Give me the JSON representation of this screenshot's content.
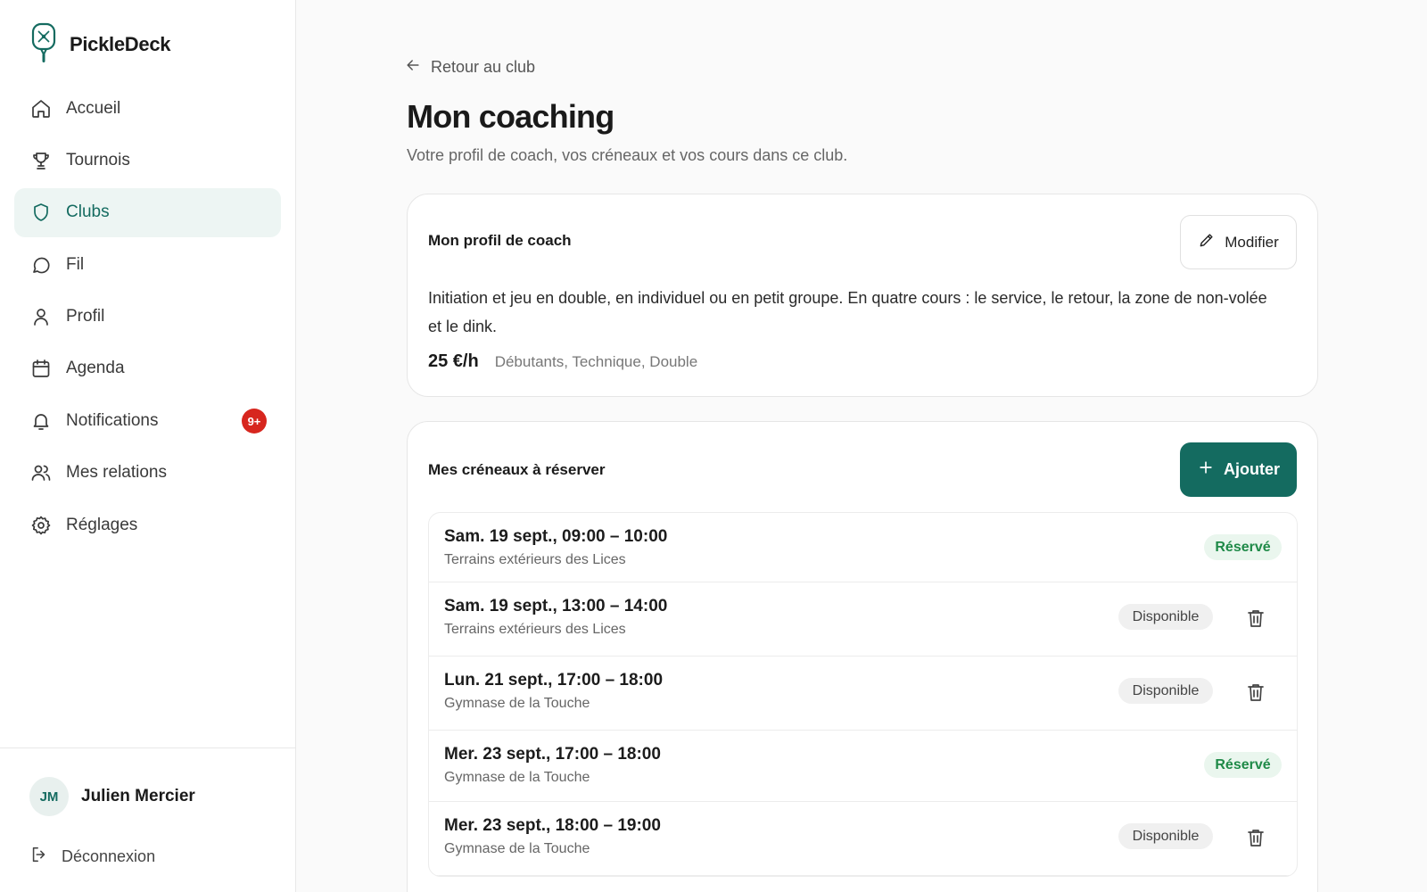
{
  "app": {
    "name": "PickleDeck"
  },
  "sidebar": {
    "items": [
      {
        "label": "Accueil",
        "icon": "home-icon"
      },
      {
        "label": "Tournois",
        "icon": "trophy-icon"
      },
      {
        "label": "Clubs",
        "icon": "shield-icon",
        "active": true
      },
      {
        "label": "Fil",
        "icon": "chat-icon"
      },
      {
        "label": "Profil",
        "icon": "user-icon"
      },
      {
        "label": "Agenda",
        "icon": "calendar-icon"
      },
      {
        "label": "Notifications",
        "icon": "bell-icon",
        "badge": "9+"
      },
      {
        "label": "Mes relations",
        "icon": "users-icon"
      },
      {
        "label": "Réglages",
        "icon": "gear-icon"
      }
    ],
    "user": {
      "initials": "JM",
      "name": "Julien Mercier"
    },
    "logout_label": "Déconnexion"
  },
  "main": {
    "back_label": "Retour au club",
    "title": "Mon coaching",
    "subtitle": "Votre profil de coach, vos créneaux et vos cours dans ce club.",
    "profile_card": {
      "title": "Mon profil de coach",
      "edit_label": "Modifier",
      "description": "Initiation et jeu en double, en individuel ou en petit groupe. En quatre cours : le service, le retour, la zone de non-volée et le dink.",
      "price": "25 €/h",
      "tags": "Débutants, Technique, Double"
    },
    "slots_card": {
      "title": "Mes créneaux à réserver",
      "add_label": "Ajouter",
      "slots": [
        {
          "date": "Sam. 19 sept., 09:00 – 10:00",
          "place": "Terrains extérieurs des Lices",
          "status": "Réservé"
        },
        {
          "date": "Sam. 19 sept., 13:00 – 14:00",
          "place": "Terrains extérieurs des Lices",
          "status": "Disponible"
        },
        {
          "date": "Lun. 21 sept., 17:00 – 18:00",
          "place": "Gymnase de la Touche",
          "status": "Disponible"
        },
        {
          "date": "Mer. 23 sept., 17:00 – 18:00",
          "place": "Gymnase de la Touche",
          "status": "Réservé"
        },
        {
          "date": "Mer. 23 sept., 18:00 – 19:00",
          "place": "Gymnase de la Touche",
          "status": "Disponible"
        }
      ]
    }
  },
  "colors": {
    "accent": "#146b60",
    "active_bg": "#edf5f3",
    "badge": "#d7261e",
    "reserved_text": "#1f8a48",
    "reserved_bg": "#eaf6ee",
    "available_bg": "#f0f0f0"
  }
}
